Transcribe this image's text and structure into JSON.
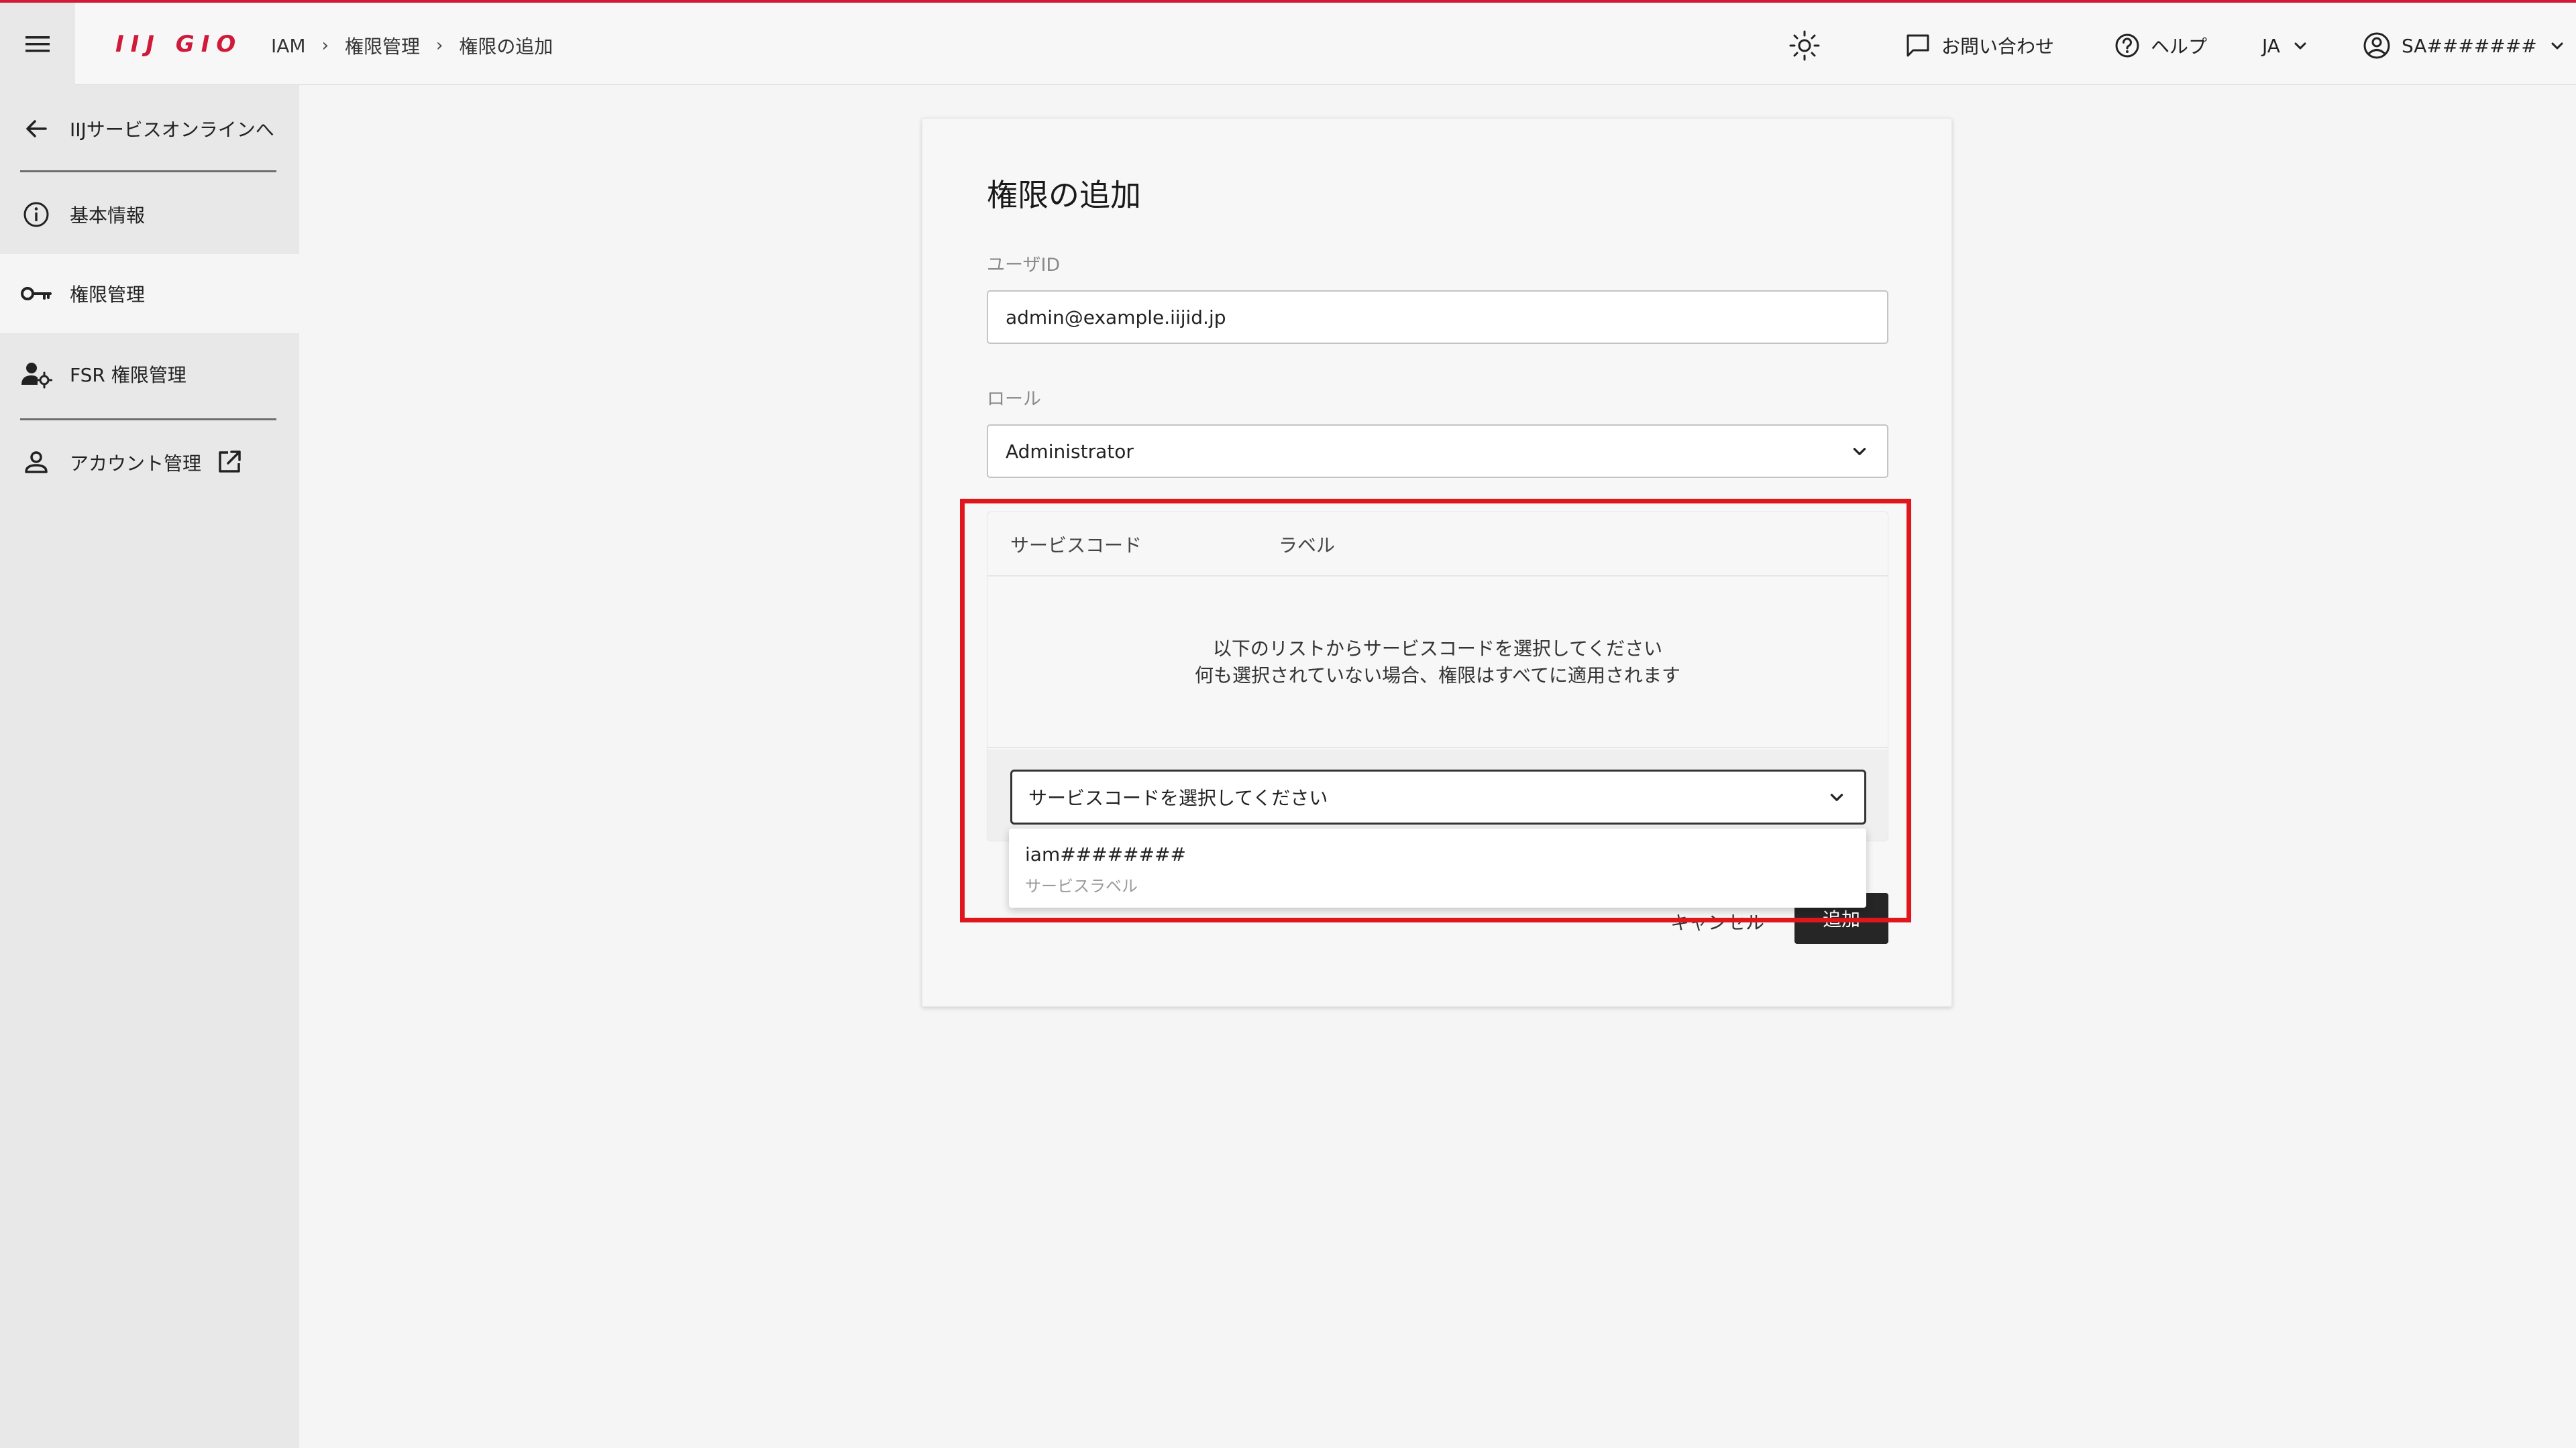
{
  "header": {
    "logo": "IIJ GIO",
    "breadcrumb": [
      "IAM",
      "権限管理",
      "権限の追加"
    ],
    "contact": "お問い合わせ",
    "help": "ヘルプ",
    "language": "JA",
    "user": "SA#######"
  },
  "sidebar": {
    "back": "IIJサービスオンラインへ",
    "items": [
      {
        "label": "基本情報",
        "icon": "info-icon"
      },
      {
        "label": "権限管理",
        "icon": "key-icon"
      },
      {
        "label": "FSR 権限管理",
        "icon": "user-settings-icon"
      }
    ],
    "account": "アカウント管理"
  },
  "form": {
    "title": "権限の追加",
    "user_id_label": "ユーザID",
    "user_id_value": "admin@example.iijid.jp",
    "role_label": "ロール",
    "role_value": "Administrator",
    "table": {
      "col_code": "サービスコード",
      "col_label": "ラベル",
      "empty_line1": "以下のリストからサービスコードを選択してください",
      "empty_line2": "何も選択されていない場合、権限はすべてに適用されます",
      "select_placeholder": "サービスコードを選択してください"
    },
    "cancel": "キャンセル",
    "add": "追加"
  },
  "dropdown": {
    "options": [
      {
        "code": "iam########",
        "label": "サービスラベル"
      }
    ]
  },
  "colors": {
    "brand": "#d1193a",
    "highlight": "#e0161d"
  }
}
